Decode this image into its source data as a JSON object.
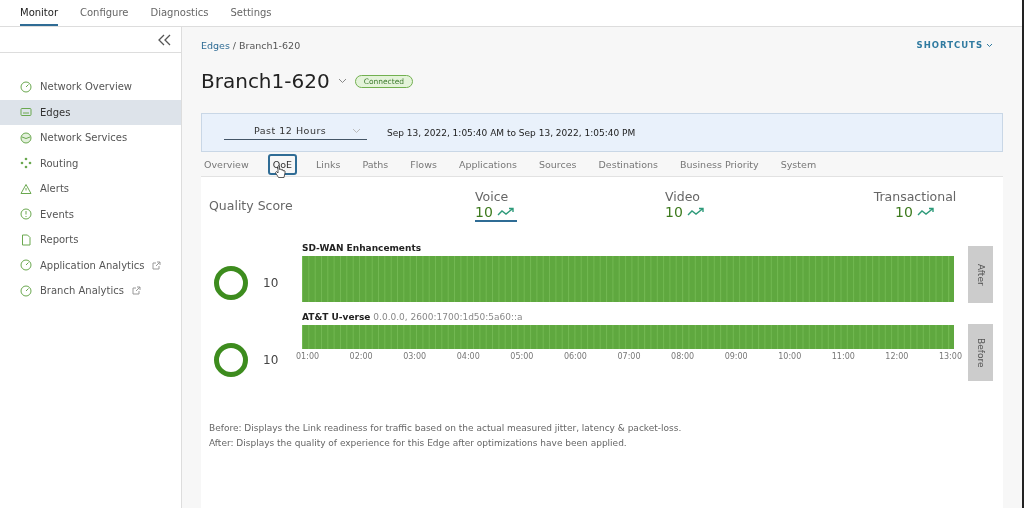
{
  "top_nav": [
    {
      "label": "Monitor",
      "selected": true
    },
    {
      "label": "Configure",
      "selected": false
    },
    {
      "label": "Diagnostics",
      "selected": false
    },
    {
      "label": "Settings",
      "selected": false
    }
  ],
  "sidebar": {
    "items": [
      {
        "label": "Network Overview",
        "selected": false,
        "external": false
      },
      {
        "label": "Edges",
        "selected": true,
        "external": false
      },
      {
        "label": "Network Services",
        "selected": false,
        "external": false
      },
      {
        "label": "Routing",
        "selected": false,
        "external": false
      },
      {
        "label": "Alerts",
        "selected": false,
        "external": false
      },
      {
        "label": "Events",
        "selected": false,
        "external": false
      },
      {
        "label": "Reports",
        "selected": false,
        "external": false
      },
      {
        "label": "Application Analytics",
        "selected": false,
        "external": true
      },
      {
        "label": "Branch Analytics",
        "selected": false,
        "external": true
      }
    ]
  },
  "breadcrumb": {
    "link": "Edges",
    "separator": "/",
    "current": "Branch1-620"
  },
  "shortcuts": "SHORTCUTS",
  "title": "Branch1-620",
  "status_badge": "Connected",
  "time_range": {
    "value": "Past 12 Hours",
    "range": "Sep 13, 2022, 1:05:40 AM to Sep 13, 2022, 1:05:40 PM"
  },
  "tabs": [
    {
      "label": "Overview",
      "selected": false
    },
    {
      "label": "QoE",
      "selected": true
    },
    {
      "label": "Links",
      "selected": false
    },
    {
      "label": "Paths",
      "selected": false
    },
    {
      "label": "Flows",
      "selected": false
    },
    {
      "label": "Applications",
      "selected": false
    },
    {
      "label": "Sources",
      "selected": false
    },
    {
      "label": "Destinations",
      "selected": false
    },
    {
      "label": "Business Priority",
      "selected": false
    },
    {
      "label": "System",
      "selected": false
    }
  ],
  "quality_label": "Quality Score",
  "scores": [
    {
      "label": "Voice",
      "value": "10",
      "selected": true
    },
    {
      "label": "Video",
      "value": "10",
      "selected": false
    },
    {
      "label": "Transactional",
      "value": "10",
      "selected": false
    }
  ],
  "rows": [
    {
      "score": "10",
      "title": "SD-WAN Enhancements",
      "detail": "",
      "toggle": "After"
    },
    {
      "score": "10",
      "title": "AT&T U-verse",
      "detail": "0.0.0.0, 2600:1700:1d50:5a60::a",
      "toggle": "Before"
    }
  ],
  "axis": [
    "01:00",
    "02:00",
    "03:00",
    "04:00",
    "05:00",
    "06:00",
    "07:00",
    "08:00",
    "09:00",
    "10:00",
    "11:00",
    "12:00",
    "13:00"
  ],
  "notes": [
    "Before: Displays the Link readiness for traffic based on the actual measured jitter, latency & packet-loss.",
    "After: Displays the quality of experience for this Edge after optimizations have been applied."
  ]
}
